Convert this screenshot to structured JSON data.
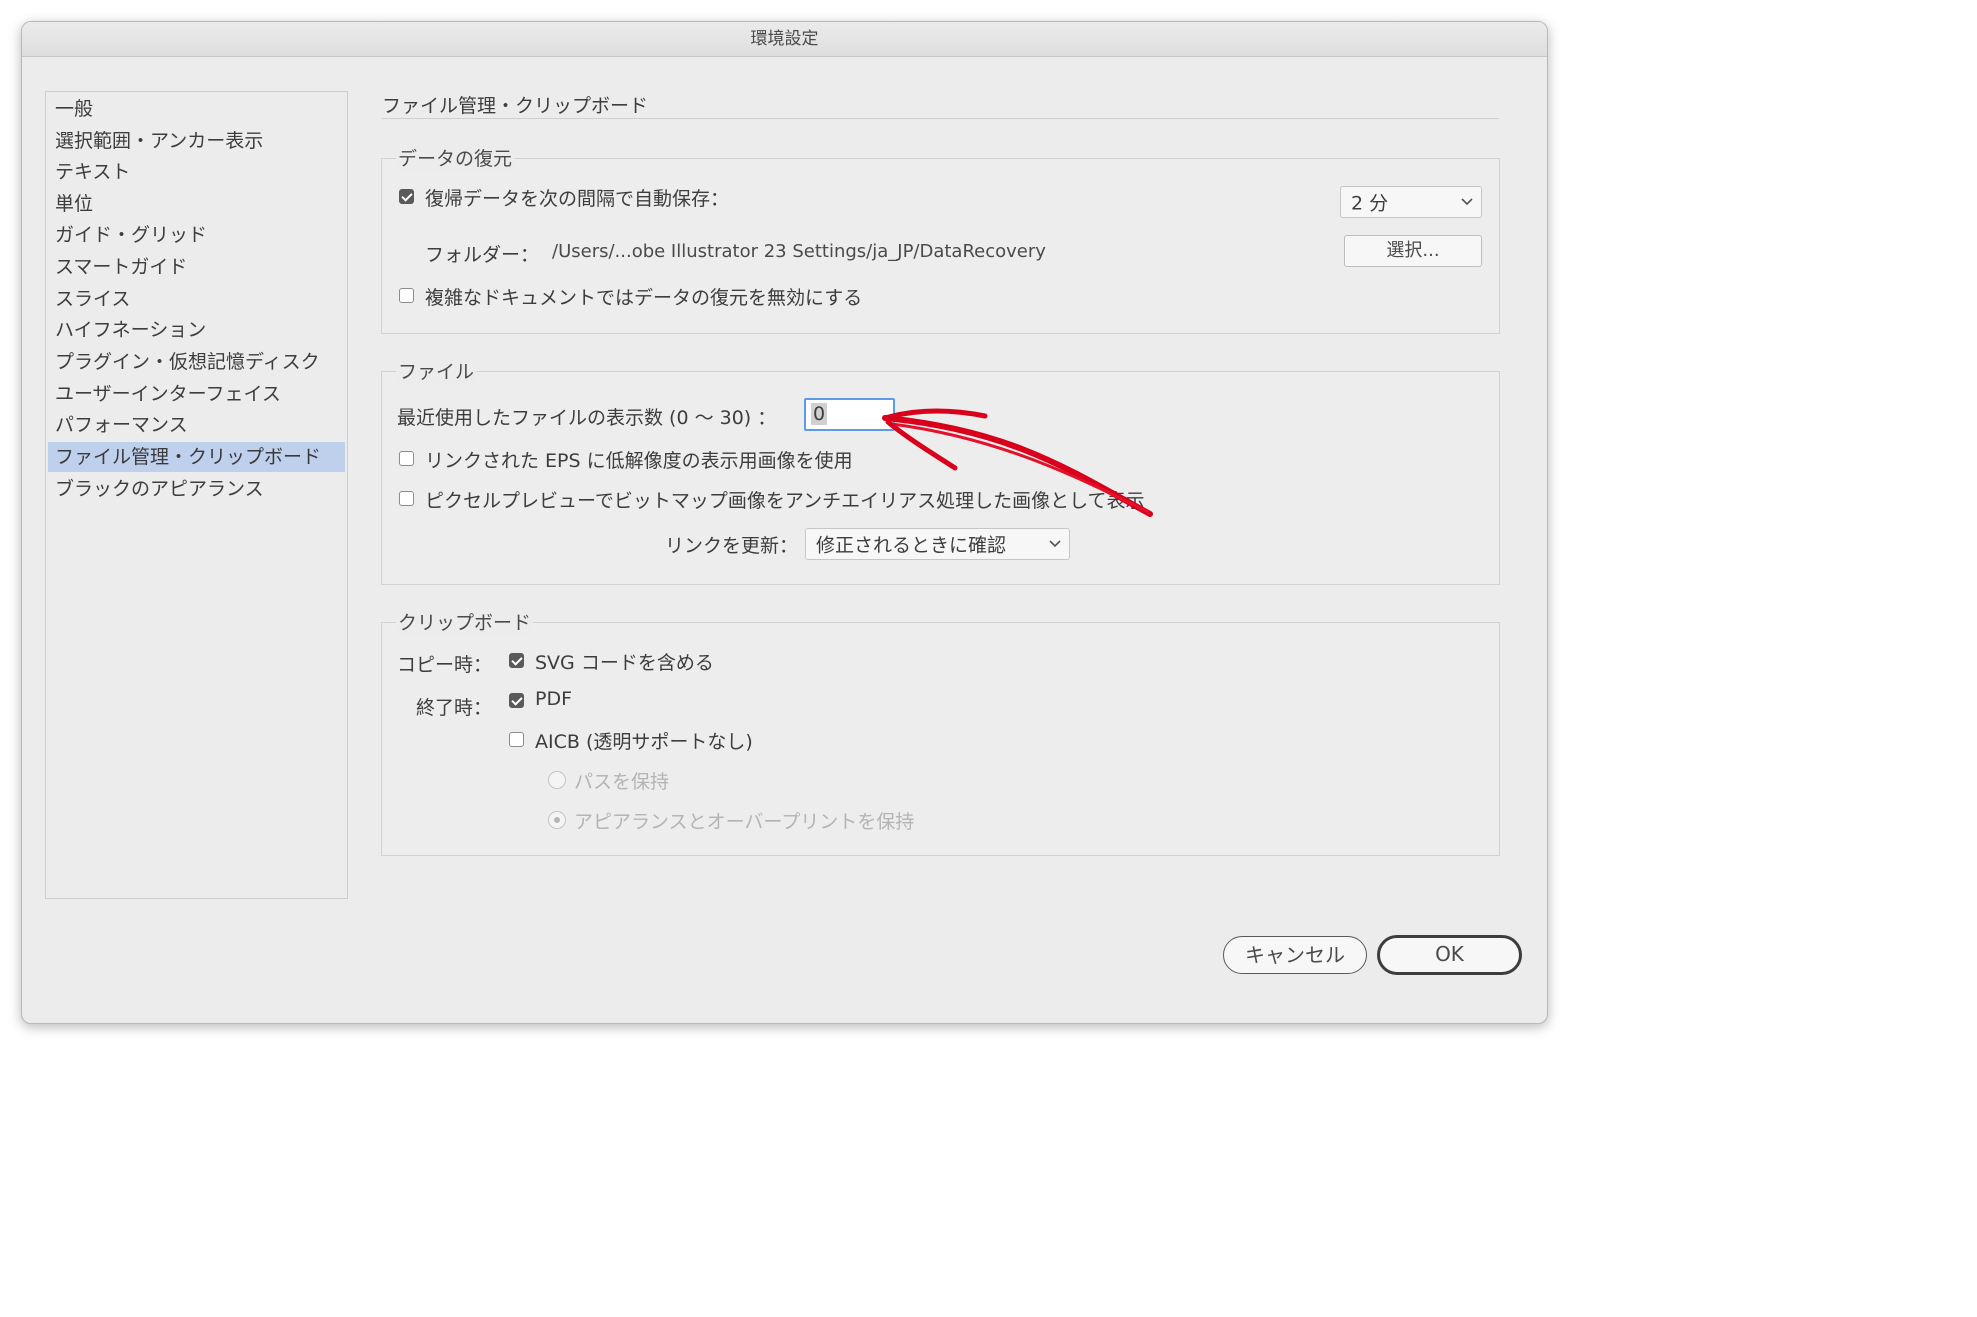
{
  "window": {
    "title": "環境設定"
  },
  "sidebar": {
    "items": [
      {
        "label": "一般",
        "selected": false
      },
      {
        "label": "選択範囲・アンカー表示",
        "selected": false
      },
      {
        "label": "テキスト",
        "selected": false
      },
      {
        "label": "単位",
        "selected": false
      },
      {
        "label": "ガイド・グリッド",
        "selected": false
      },
      {
        "label": "スマートガイド",
        "selected": false
      },
      {
        "label": "スライス",
        "selected": false
      },
      {
        "label": "ハイフネーション",
        "selected": false
      },
      {
        "label": "プラグイン・仮想記憶ディスク",
        "selected": false
      },
      {
        "label": "ユーザーインターフェイス",
        "selected": false
      },
      {
        "label": "パフォーマンス",
        "selected": false
      },
      {
        "label": "ファイル管理・クリップボード",
        "selected": true
      },
      {
        "label": "ブラックのアピアランス",
        "selected": false
      }
    ]
  },
  "main": {
    "page_title": "ファイル管理・クリップボード",
    "data_recovery": {
      "legend": "データの復元",
      "autosave": {
        "label": "復帰データを次の間隔で自動保存：",
        "checked": true
      },
      "interval": {
        "value": "2 分"
      },
      "folder": {
        "label": "フォルダー：",
        "path": "/Users/...obe Illustrator 23 Settings/ja_JP/DataRecovery"
      },
      "choose_button": "選択...",
      "disable_complex": {
        "label": "複雑なドキュメントではデータの復元を無効にする",
        "checked": false
      }
    },
    "files": {
      "legend": "ファイル",
      "recent_files": {
        "label": "最近使用したファイルの表示数 (0 〜 30) ：",
        "value": "0"
      },
      "low_res_eps": {
        "label": "リンクされた EPS に低解像度の表示用画像を使用",
        "checked": false
      },
      "pixel_preview": {
        "label": "ピクセルプレビューでビットマップ画像をアンチエイリアス処理した画像として表示",
        "checked": false
      },
      "update_links": {
        "label": "リンクを更新：",
        "value": "修正されるときに確認"
      }
    },
    "clipboard": {
      "legend": "クリップボード",
      "on_copy": {
        "label": "コピー時："
      },
      "svg_code": {
        "label": "SVG コードを含める",
        "checked": true
      },
      "on_quit": {
        "label": "終了時："
      },
      "pdf": {
        "label": "PDF",
        "checked": true
      },
      "aicb": {
        "label": "AICB (透明サポートなし)",
        "checked": false
      },
      "preserve_paths": {
        "label": "パスを保持",
        "selected": false,
        "enabled": false
      },
      "preserve_appearance": {
        "label": "アピアランスとオーバープリントを保持",
        "selected": true,
        "enabled": false
      }
    }
  },
  "buttons": {
    "cancel": "キャンセル",
    "ok": "OK"
  },
  "colors": {
    "window_bg": "#ececec",
    "sidebar_selection": "#bfd0ec",
    "focus_ring": "#5d9be8",
    "annotation_arrow": "#d9001b"
  },
  "annotation": {
    "type": "red-arrow",
    "points_to": "recent-files-input"
  }
}
